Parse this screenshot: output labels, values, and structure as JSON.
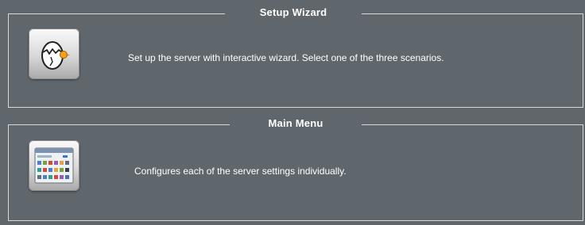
{
  "setup_wizard": {
    "title": "Setup Wizard",
    "description": "Set up the server with interactive wizard. Select one of the three scenarios.",
    "icon": "egg-hatching-icon"
  },
  "main_menu": {
    "title": "Main Menu",
    "description": "Configures each of the server settings individually.",
    "icon": "settings-grid-icon"
  },
  "colors": {
    "background": "#5f676d",
    "border": "#d7dadc",
    "text": "#ffffff"
  }
}
